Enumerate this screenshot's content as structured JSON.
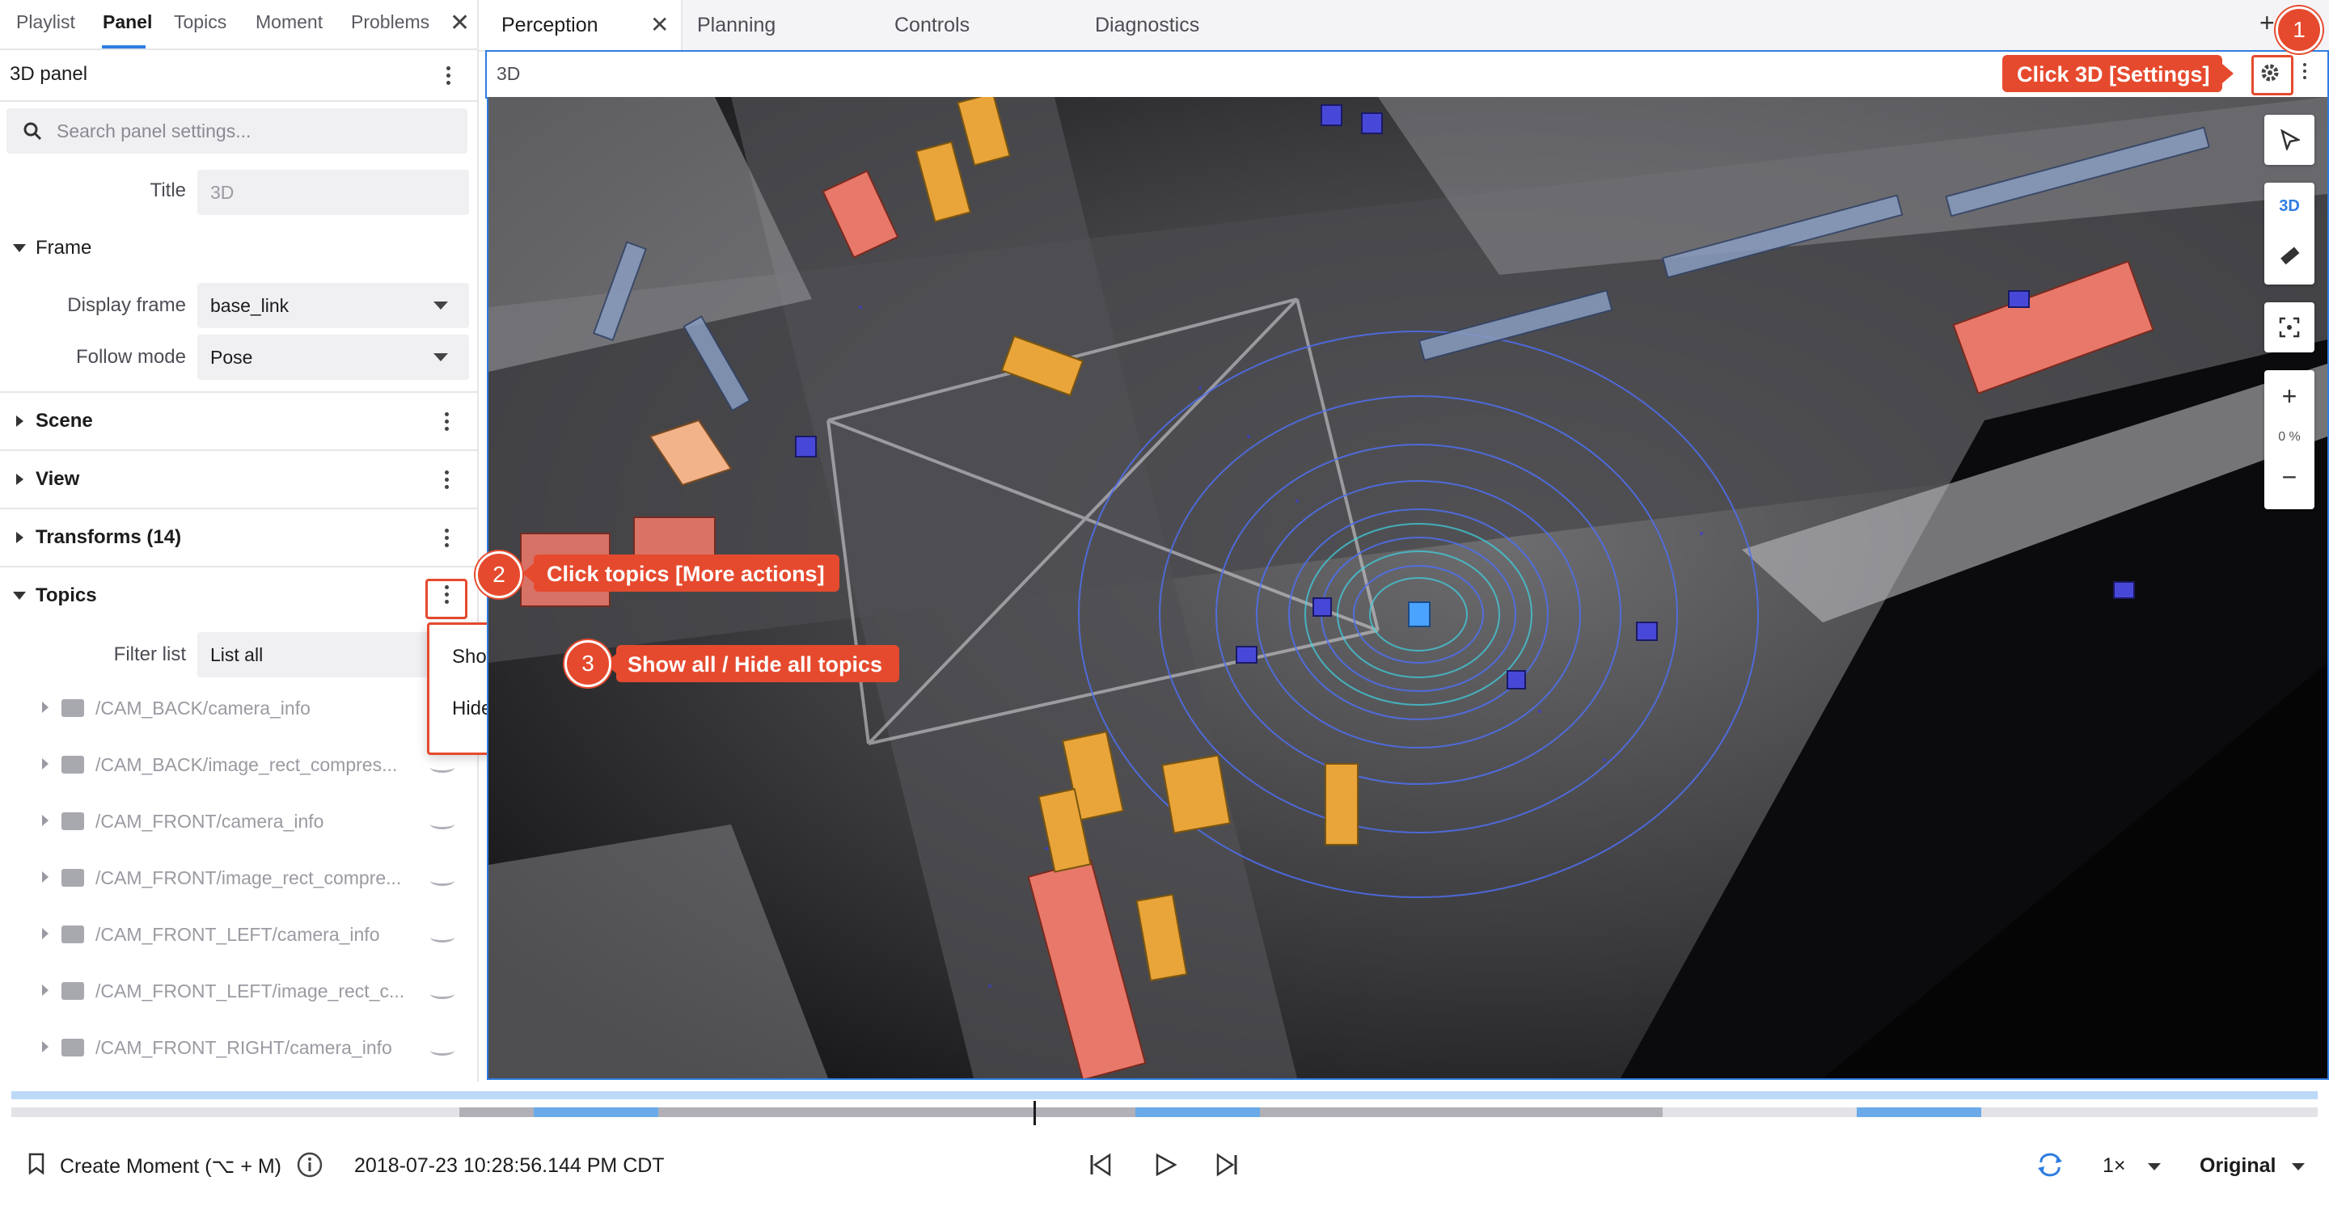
{
  "sidebar": {
    "tabs": [
      "Playlist",
      "Panel",
      "Topics",
      "Moment",
      "Problems"
    ],
    "panel_name": "3D panel",
    "search_placeholder": "Search panel settings...",
    "title_label": "Title",
    "title_placeholder": "3D",
    "frame_section": "Frame",
    "display_frame_label": "Display frame",
    "display_frame_value": "base_link",
    "follow_mode_label": "Follow mode",
    "follow_mode_value": "Pose",
    "sections": [
      "Scene",
      "View",
      "Transforms (14)"
    ],
    "topics_section": "Topics",
    "filter_label": "Filter list",
    "filter_value": "List all",
    "topics": [
      {
        "name": "/CAM_BACK/camera_info",
        "icon": "camera-icon"
      },
      {
        "name": "/CAM_BACK/image_rect_compres...",
        "icon": "image-icon"
      },
      {
        "name": "/CAM_FRONT/camera_info",
        "icon": "camera-icon"
      },
      {
        "name": "/CAM_FRONT/image_rect_compre...",
        "icon": "image-icon"
      },
      {
        "name": "/CAM_FRONT_LEFT/camera_info",
        "icon": "camera-icon"
      },
      {
        "name": "/CAM_FRONT_LEFT/image_rect_c...",
        "icon": "image-icon"
      },
      {
        "name": "/CAM_FRONT_RIGHT/camera_info",
        "icon": "camera-icon"
      }
    ]
  },
  "topics_menu": {
    "show_all": "Show all",
    "hide_all": "Hide all"
  },
  "panel_tabs": [
    "Perception",
    "Planning",
    "Controls",
    "Diagnostics"
  ],
  "add_tab": "+",
  "panel": {
    "title": "3D"
  },
  "toolbar": {
    "mode_3d": "3D",
    "zoom_in": "+",
    "zoom_level": "0 %",
    "zoom_out": "−"
  },
  "callouts": [
    {
      "number": "1",
      "text": "Click 3D [Settings]"
    },
    {
      "number": "2",
      "text": "Click topics [More actions]"
    },
    {
      "number": "3",
      "text": "Show all / Hide all topics"
    }
  ],
  "playback": {
    "create_moment": "Create Moment (⌥ + M)",
    "timestamp": "2018-07-23 10:28:56.144 PM CDT",
    "speed": "1×",
    "scale": "Original"
  },
  "colors": {
    "accent": "#2f7de1",
    "callout": "#e64a2e"
  }
}
